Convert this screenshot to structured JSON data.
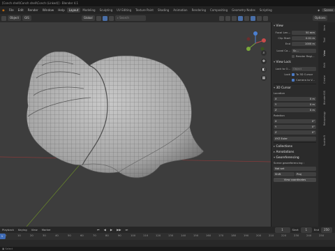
{
  "window": {
    "title": "[Conch shell\\Conch shell\\Conch (Linked)] - Blender 4.1"
  },
  "menubar": {
    "items": [
      "File",
      "Edit",
      "Render",
      "Window",
      "Help"
    ],
    "workspaces": [
      "Layout",
      "Modeling",
      "Sculpting",
      "UV Editing",
      "Texture Paint",
      "Shading",
      "Animation",
      "Rendering",
      "Compositing",
      "Geometry Nodes",
      "Scripting"
    ],
    "active_workspace": "Layout",
    "scene_label": "Scene"
  },
  "viewport_header": {
    "object_label": "Object",
    "gis_label": "GIS",
    "orientation": "Global",
    "search_placeholder": "Search",
    "options_label": "Options"
  },
  "npanel": {
    "view_section": "View",
    "focal_length": {
      "label": "Focal Len...",
      "value": "50 mm"
    },
    "clip_start": {
      "label": "Clip Start",
      "value": "0.01 m"
    },
    "clip_end": {
      "label": "End",
      "value": "1000 m"
    },
    "local_camera": {
      "label": "Local Ca...",
      "value": "Sc..."
    },
    "render_region": "Render Regi...",
    "view_lock_section": "View Lock",
    "lock_to_object": {
      "label": "Lock to O...",
      "value": "Object"
    },
    "lock_to": "Lock",
    "to_3d_cursor": "To 3D Cursor",
    "camera_to_view": "Camera to V...",
    "cursor_section": "3D Cursor",
    "location_label": "Location",
    "loc": [
      {
        "axis": "X",
        "value": "0 m"
      },
      {
        "axis": "Y",
        "value": "0 m"
      },
      {
        "axis": "Z",
        "value": "0 m"
      }
    ],
    "rotation_label": "Rotation",
    "rot": [
      {
        "axis": "X",
        "value": "0°"
      },
      {
        "axis": "Y",
        "value": "0°"
      },
      {
        "axis": "Z",
        "value": "0°"
      }
    ],
    "rotation_mode": "XYZ Euler",
    "collections_section": "Collections",
    "annotations_section": "Annotations",
    "georef_section": "Georeferencing",
    "georef_label": "Scene georeferencing :",
    "georef_status": "Not set",
    "georef_x": "Shift",
    "georef_y": "Proj",
    "view_coords_button": "View coordinates"
  },
  "sidetabs": [
    "Item",
    "Tool",
    "View",
    "Edit",
    "Create",
    "BlenderGIS",
    "Retopology",
    "Scatter5"
  ],
  "timeline": {
    "labels": {
      "playback": "Playback",
      "keying": "Keying",
      "view": "View",
      "marker": "Marker"
    },
    "current_frame": "1",
    "start_label": "Start",
    "start_value": "1",
    "end_label": "End",
    "end_value": "250",
    "ticks": [
      "0",
      "10",
      "20",
      "30",
      "40",
      "50",
      "60",
      "70",
      "80",
      "90",
      "100",
      "110",
      "120",
      "130",
      "140",
      "150",
      "160",
      "170",
      "180",
      "190",
      "200",
      "210",
      "220",
      "230",
      "240",
      "250"
    ]
  },
  "statusbar": {
    "text": "Select"
  }
}
